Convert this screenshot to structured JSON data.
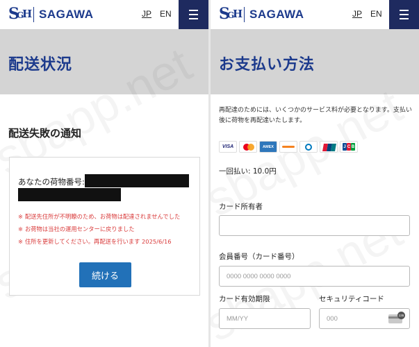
{
  "brand": {
    "name": "SAGAWA",
    "mark": [
      "S",
      "G",
      "H"
    ]
  },
  "header": {
    "lang_jp": "JP",
    "lang_en": "EN"
  },
  "watermark": "sbapp.net",
  "left": {
    "page_title": "配送状況",
    "notice_title": "配送失敗の通知",
    "tracking_label": "あなたの荷物番号:",
    "messages": [
      "配送先住所が不明瞭のため、お荷物は配達されませんでした",
      "お荷物は当社の運用センターに戻りました",
      "住所を更新してください。再配送を行います 2025/6/16"
    ],
    "message_mark": "※",
    "continue_button": "続ける"
  },
  "right": {
    "page_title": "お支払い方法",
    "intro": "再配達のためには、いくつかのサービス料が必要となります。支払い後に荷物を再配達いたします。",
    "cards": {
      "visa": "VISA",
      "amex": "AMEX",
      "jcb": [
        "J",
        "C",
        "B"
      ]
    },
    "amount": "一回払い: 10.0円",
    "cardholder_label": "カード所有者",
    "cardholder_value": "",
    "card_number_label": "会員番号（カード番号）",
    "card_number_placeholder": "0000 0000 0000 0000",
    "expiry_label": "カード有効期限",
    "expiry_placeholder": "MM/YY",
    "cvv_label": "セキュリティコード",
    "cvv_placeholder": "000",
    "cvv_badge": "135"
  }
}
